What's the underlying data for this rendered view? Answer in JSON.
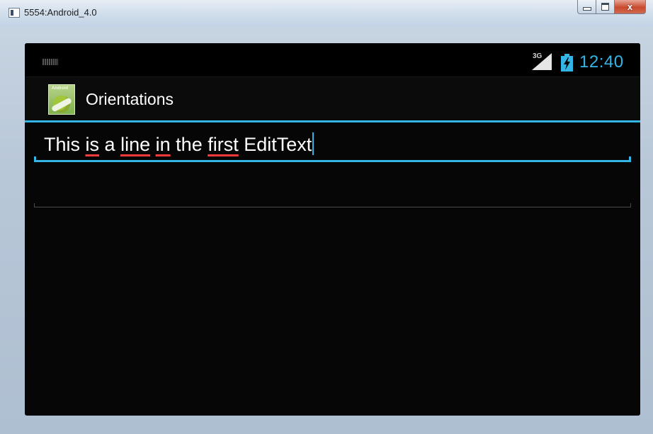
{
  "window": {
    "title": "5554:Android_4.0",
    "buttons": {
      "minimize": "minimize",
      "maximize": "maximize",
      "close": "x"
    }
  },
  "status_bar": {
    "network_label": "3G",
    "time": "12:40",
    "clock_color": "#33b5e5",
    "icons": [
      "keyboard-icon",
      "signal-icon",
      "battery-charging-icon"
    ]
  },
  "action_bar": {
    "app_icon_text": "Android",
    "title": "Orientations"
  },
  "edit_texts": [
    {
      "words": [
        "This",
        "is",
        "a",
        "line",
        "in",
        "the",
        "first",
        "EditText"
      ],
      "misspelled_words": [
        "is",
        "line",
        "in",
        "first"
      ],
      "focused": true
    },
    {
      "value": "",
      "focused": false
    }
  ],
  "colors": {
    "accent": "#33b5e5",
    "spell_error": "#ff3b3b",
    "screen_bg": "#060606"
  }
}
